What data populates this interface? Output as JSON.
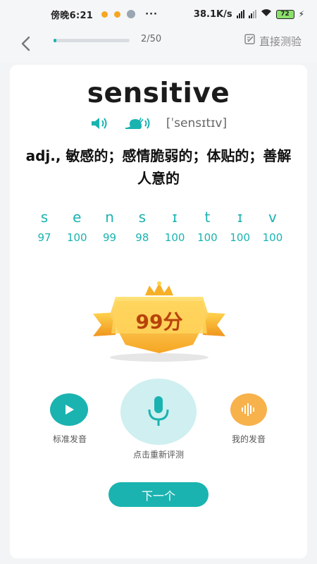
{
  "status_bar": {
    "time": "傍晚6:21",
    "more": "···",
    "network_speed": "38.1K/s",
    "battery": "72"
  },
  "header": {
    "progress_text": "2/50",
    "progress_fraction": 0.04,
    "direct_test_label": "直接测验",
    "icons": {
      "back": "back-arrow-icon",
      "test": "edit-icon"
    }
  },
  "word": {
    "text": "sensitive",
    "phonetic": "[ˈsensɪtɪv]",
    "definition": "adj., 敏感的；感情脆弱的；体贴的；善解人意的"
  },
  "phonemes": {
    "symbols": [
      "s",
      "e",
      "n",
      "s",
      "ɪ",
      "t",
      "ɪ",
      "v"
    ],
    "scores": [
      "97",
      "100",
      "99",
      "98",
      "100",
      "100",
      "100",
      "100"
    ]
  },
  "result": {
    "score": "99分"
  },
  "controls": {
    "standard_label": "标准发音",
    "mic_label": "点击重新评测",
    "my_label": "我的发音",
    "next_label": "下一个"
  },
  "colors": {
    "accent": "#1ab3b0",
    "accent_light": "#cfeff0",
    "orange": "#f7b24b",
    "badge_text": "#b8430a"
  }
}
